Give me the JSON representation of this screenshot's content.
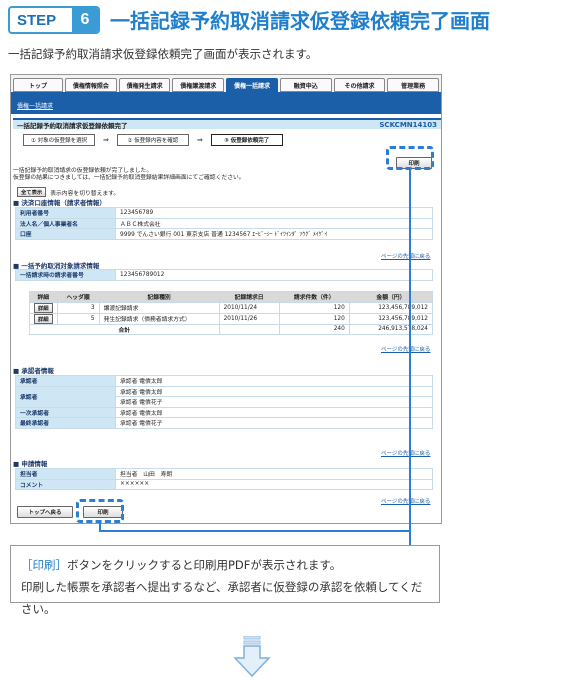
{
  "step": {
    "label": "STEP",
    "number": "6",
    "title": "一括記録予約取消請求仮登録依頼完了画面"
  },
  "intro": "一括記録予約取消請求仮登録依頼完了画面が表示されます。",
  "tabs": [
    "トップ",
    "債権情報照会",
    "債権発生請求",
    "債権譲渡請求",
    "債権一括請求",
    "融資申込",
    "その他請求",
    "管理業務"
  ],
  "active_tab": 4,
  "breadcrumb": "債権一括請求",
  "screen_title": "一括記録予約取消請求仮登録依頼完了",
  "screen_code": "SCKCMN14103",
  "steps": [
    "① 対象の仮登録を選択",
    "② 仮登録内容を確認",
    "③ 仮登録依頼完了"
  ],
  "print_label": "印刷",
  "message": [
    "一括記録予約取消請求の仮登録依頼が完了しました。",
    "仮登録の結果につきましては、一括記録予約取消登録結果詳細画面にてご確認ください。"
  ],
  "show_all": {
    "button": "全て表示",
    "text": "表示内容を切り替えます。"
  },
  "sections": {
    "account": {
      "title": "決済口座情報（請求者情報）",
      "rows": [
        {
          "label": "利用者番号",
          "value": "123456789"
        },
        {
          "label": "法人名／個人事業者名",
          "value": "ＡＢＣ株式会社"
        },
        {
          "label": "口座",
          "value": "9999 でんさい銀行 001 東京支店 普通 1234567 ｴｰﾋﾞｰｼｰ ﾄﾞｲﾂｲﾝﾀﾞ ｿｳｸﾞ ﾒｲｹﾞｲ"
        }
      ]
    },
    "target": {
      "title": "一括予約取消対象請求情報",
      "number_label": "一括請求時の請求者番号",
      "number_value": "123456789012",
      "headers": [
        "詳細",
        "ヘッダ順",
        "記録種別",
        "記録請求日",
        "請求件数（件）",
        "金額（円）"
      ],
      "rows": [
        {
          "detail": "詳細",
          "order": "3",
          "type": "譲渡記録請求",
          "date": "2010/11/24",
          "count": "120",
          "amount": "123,456,789,012"
        },
        {
          "detail": "詳細",
          "order": "5",
          "type": "発生記録請求（債務者請求方式）",
          "date": "2010/11/26",
          "count": "120",
          "amount": "123,456,789,012"
        }
      ],
      "total": {
        "label": "合計",
        "count": "240",
        "amount": "246,913,578,024"
      }
    },
    "approver": {
      "title": "承認者情報",
      "rows": [
        {
          "label": "承認者",
          "values": [
            "承認者 電債太郎"
          ]
        },
        {
          "label": "承認者",
          "values": [
            "承認者 電債太郎",
            "承認者 電債花子"
          ]
        },
        {
          "label": "一次承認者",
          "values": [
            "承認者 電債太郎"
          ]
        },
        {
          "label": "最終承認者",
          "values": [
            "承認者 電債花子"
          ]
        }
      ]
    },
    "application": {
      "title": "申請情報",
      "rows": [
        {
          "label": "担当者",
          "value": "担当者　山田　寿朗"
        },
        {
          "label": "コメント",
          "value": "××××××"
        }
      ]
    }
  },
  "back_to_top_link": "ページの先頭に戻る",
  "bottom_buttons": {
    "top": "トップへ戻る",
    "print": "印刷"
  },
  "callout": {
    "line1_highlight": "［印刷］",
    "line1_rest": "ボタンをクリックすると印刷用PDFが表示されます。",
    "line2": "印刷した帳票を承認者へ提出するなど、承認者に仮登録の承認を依頼してください。"
  },
  "colors": {
    "accent": "#1f7fcc",
    "nav": "#1b5fa8",
    "header_cell": "#cfe6f5",
    "dash": "#2a7fd4"
  }
}
